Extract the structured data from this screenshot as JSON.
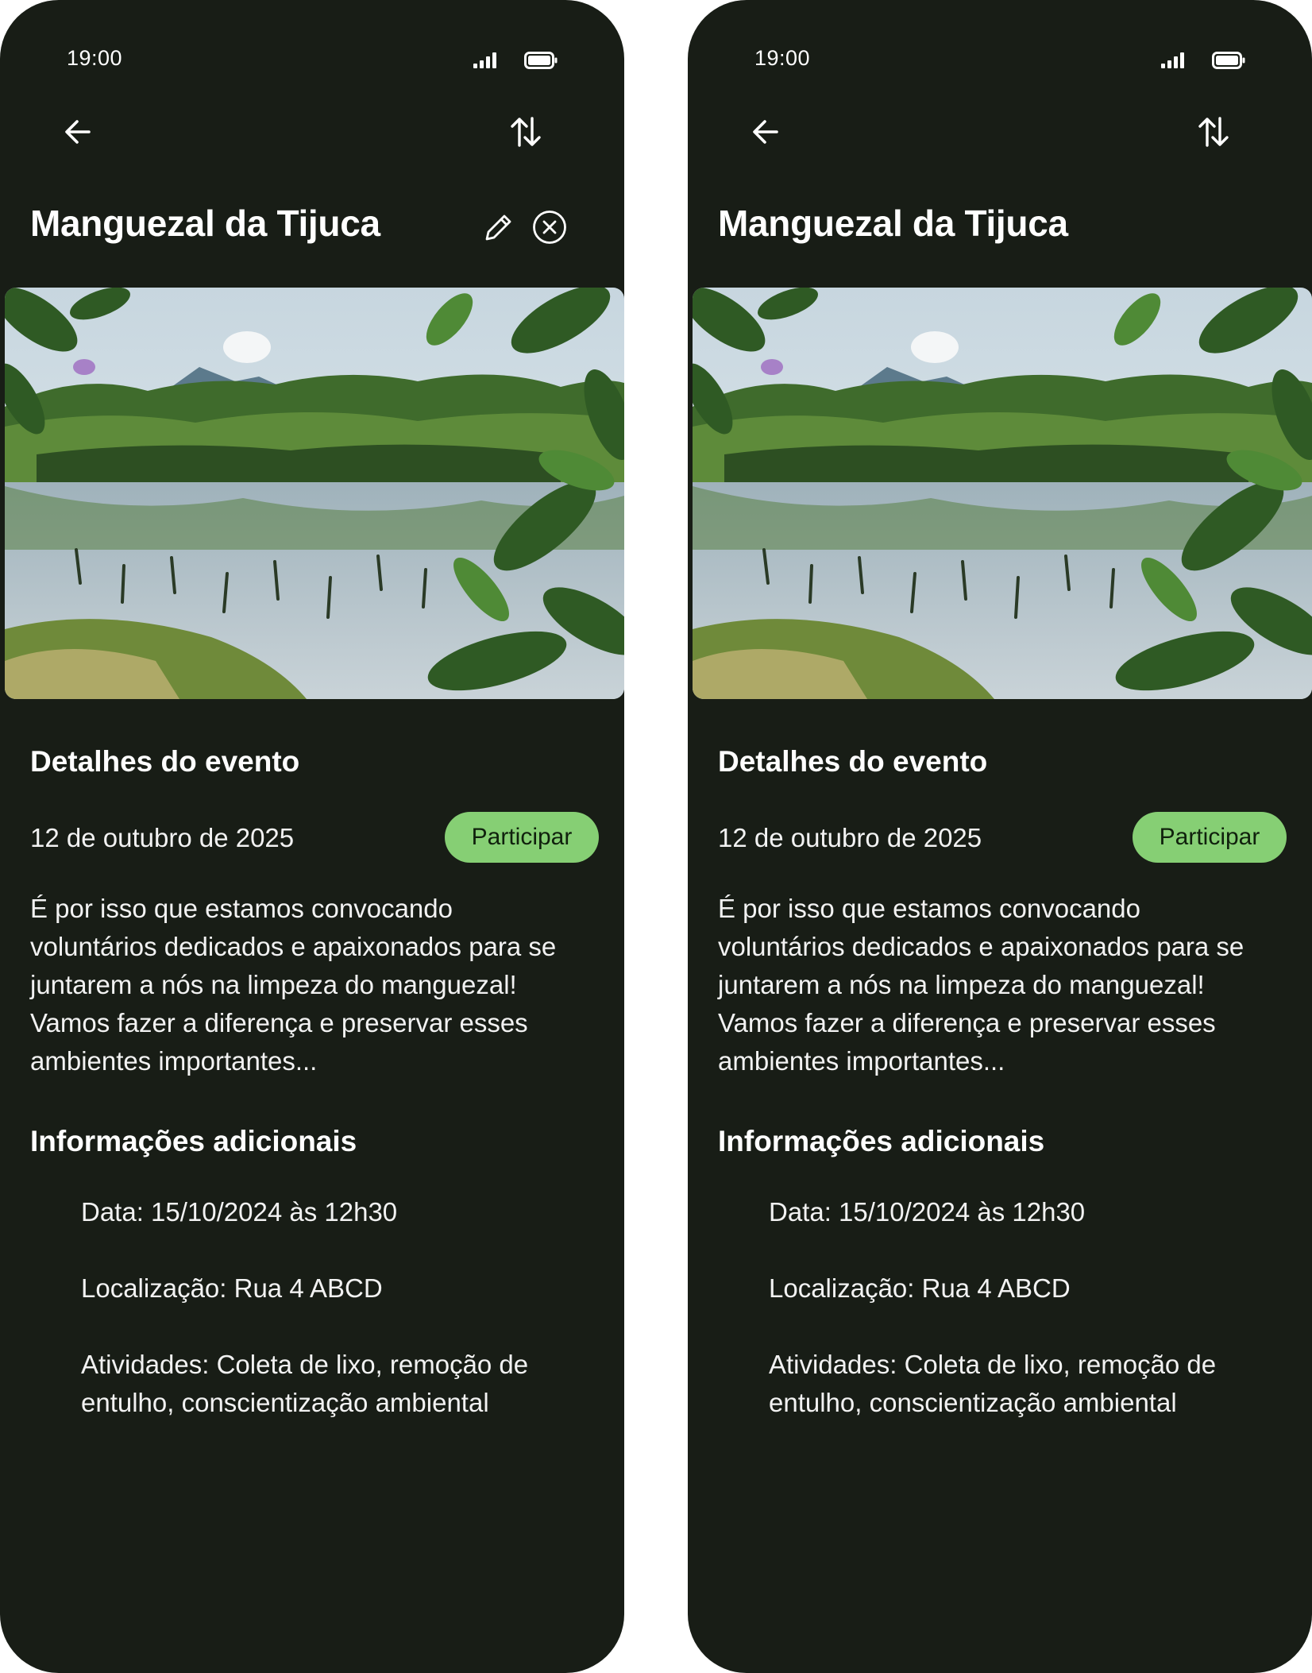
{
  "screens": [
    {
      "status": {
        "time": "19:00",
        "signal_icon": "signal-icon",
        "battery_icon": "battery-icon"
      },
      "nav": {
        "back_icon": "arrow-left-icon",
        "sort_icon": "sort-arrows-icon"
      },
      "header": {
        "title": "Manguezal da Tijuca",
        "edit_icon": "pencil-icon",
        "close_icon": "close-circle-icon"
      },
      "details": {
        "heading": "Detalhes do evento",
        "date": "12 de outubro de 2025",
        "cta_label": "Participar",
        "description": "É por isso que estamos convocando voluntários dedicados e apaixonados para se juntarem a nós na limpeza do manguezal! Vamos fazer a diferença e preservar esses ambientes importantes..."
      },
      "additional": {
        "heading": "Informações adicionais",
        "items": [
          "Data: 15/10/2024 às 12h30",
          "Localização: Rua 4 ABCD",
          "Atividades: Coleta de lixo, remoção de entulho, conscientização ambiental"
        ]
      }
    },
    {
      "status": {
        "time": "19:00",
        "signal_icon": "signal-icon",
        "battery_icon": "battery-icon"
      },
      "nav": {
        "back_icon": "arrow-left-icon",
        "sort_icon": "sort-arrows-icon"
      },
      "header": {
        "title": "Manguezal da Tijuca"
      },
      "details": {
        "heading": "Detalhes do evento",
        "date": "12 de outubro de 2025",
        "cta_label": "Participar",
        "description": "É por isso que estamos convocando voluntários dedicados e apaixonados para se juntarem a nós na limpeza do manguezal! Vamos fazer a diferença e preservar esses ambientes importantes..."
      },
      "additional": {
        "heading": "Informações adicionais",
        "items": [
          "Data: 15/10/2024 às 12h30",
          "Localização: Rua 4 ABCD",
          "Atividades: Coleta de lixo, remoção de entulho, conscientização ambiental"
        ]
      }
    }
  ],
  "colors": {
    "background": "#181d16",
    "page": "#ffffff",
    "accent": "#86cf74",
    "accent_text": "#10210d",
    "text": "#f2f2f2"
  }
}
